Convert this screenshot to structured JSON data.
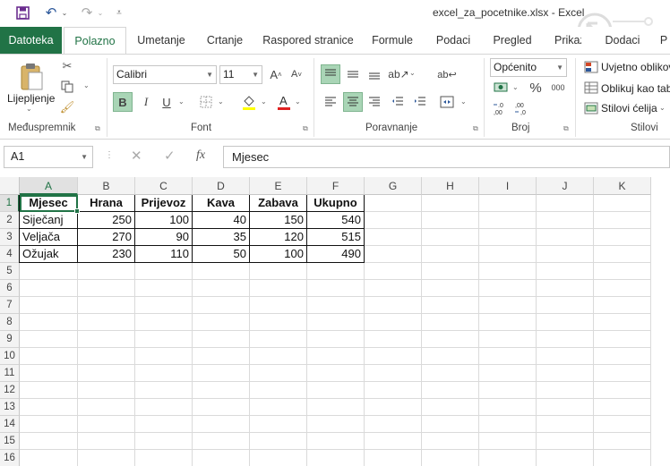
{
  "window": {
    "title": "excel_za_pocetnike.xlsx  -  Excel"
  },
  "tabs": [
    {
      "label": "Datoteka"
    },
    {
      "label": "Polazno"
    },
    {
      "label": "Umetanje"
    },
    {
      "label": "Crtanje"
    },
    {
      "label": "Raspored stranice"
    },
    {
      "label": "Formule"
    },
    {
      "label": "Podaci"
    },
    {
      "label": "Pregled"
    },
    {
      "label": "Prikaz"
    },
    {
      "label": "Dodaci"
    },
    {
      "label": "P"
    }
  ],
  "ribbon": {
    "clipboard": {
      "paste_label": "Lijepljenje",
      "group_label": "Međuspremnik"
    },
    "font": {
      "font_name": "Calibri",
      "font_size": "11",
      "bold": "B",
      "italic": "I",
      "underline": "U",
      "group_label": "Font"
    },
    "alignment": {
      "group_label": "Poravnanje"
    },
    "number": {
      "format": "Općenito",
      "percent": "%",
      "thousands": "000",
      "group_label": "Broj"
    },
    "styles": {
      "conditional": "Uvjetno oblikovanje",
      "format_table": "Oblikuj kao tablicu",
      "cell_styles": "Stilovi ćelija",
      "group_label": "Stilovi"
    }
  },
  "formula_bar": {
    "name_box": "A1",
    "fx": "fx",
    "content": "Mjesec"
  },
  "colors": {
    "accent": "#217346",
    "selected_button": "#a9d5b6"
  },
  "grid": {
    "columns": [
      "A",
      "B",
      "C",
      "D",
      "E",
      "F",
      "G",
      "H",
      "I",
      "J",
      "K"
    ],
    "rows": [
      "1",
      "2",
      "3",
      "4",
      "5",
      "6",
      "7",
      "8",
      "9",
      "10",
      "11",
      "12",
      "13",
      "14",
      "15",
      "16"
    ],
    "headers": [
      "Mjesec",
      "Hrana",
      "Prijevoz",
      "Kava",
      "Zabava",
      "Ukupno"
    ],
    "data": [
      [
        "Siječanj",
        "250",
        "100",
        "40",
        "150",
        "540"
      ],
      [
        "Veljača",
        "270",
        "90",
        "35",
        "120",
        "515"
      ],
      [
        "Ožujak",
        "230",
        "110",
        "50",
        "100",
        "490"
      ]
    ]
  }
}
